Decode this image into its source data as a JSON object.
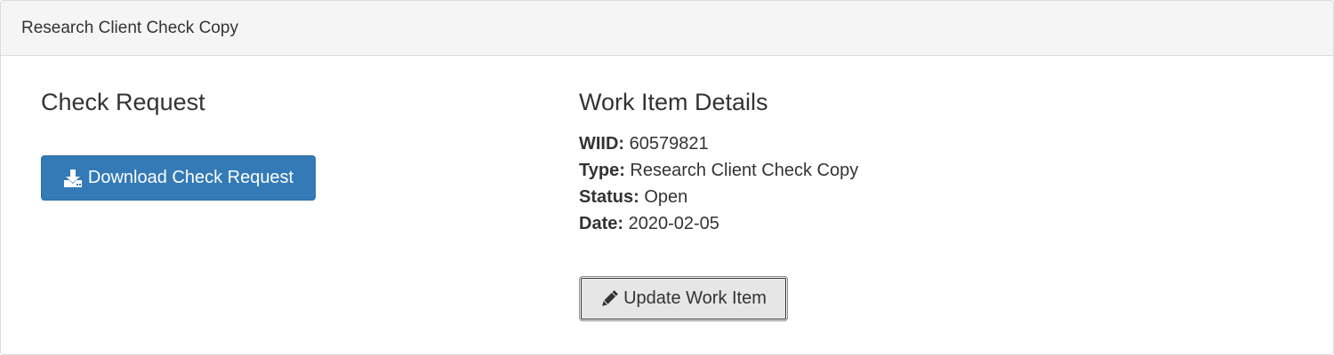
{
  "panel": {
    "title": "Research Client Check Copy"
  },
  "check_request": {
    "heading": "Check Request",
    "download_button": {
      "label": "Download Check Request",
      "icon": "download-icon"
    }
  },
  "work_item": {
    "heading": "Work Item Details",
    "details": [
      {
        "label": "WIID:",
        "value": "60579821"
      },
      {
        "label": "Type:",
        "value": "Research Client Check Copy"
      },
      {
        "label": "Status:",
        "value": "Open"
      },
      {
        "label": "Date:",
        "value": "2020-02-05"
      }
    ],
    "update_button": {
      "label": "Update Work Item",
      "icon": "pencil-icon"
    }
  },
  "colors": {
    "primary": "#337ab7",
    "panel_heading_bg": "#f5f5f5",
    "text": "#333333"
  }
}
